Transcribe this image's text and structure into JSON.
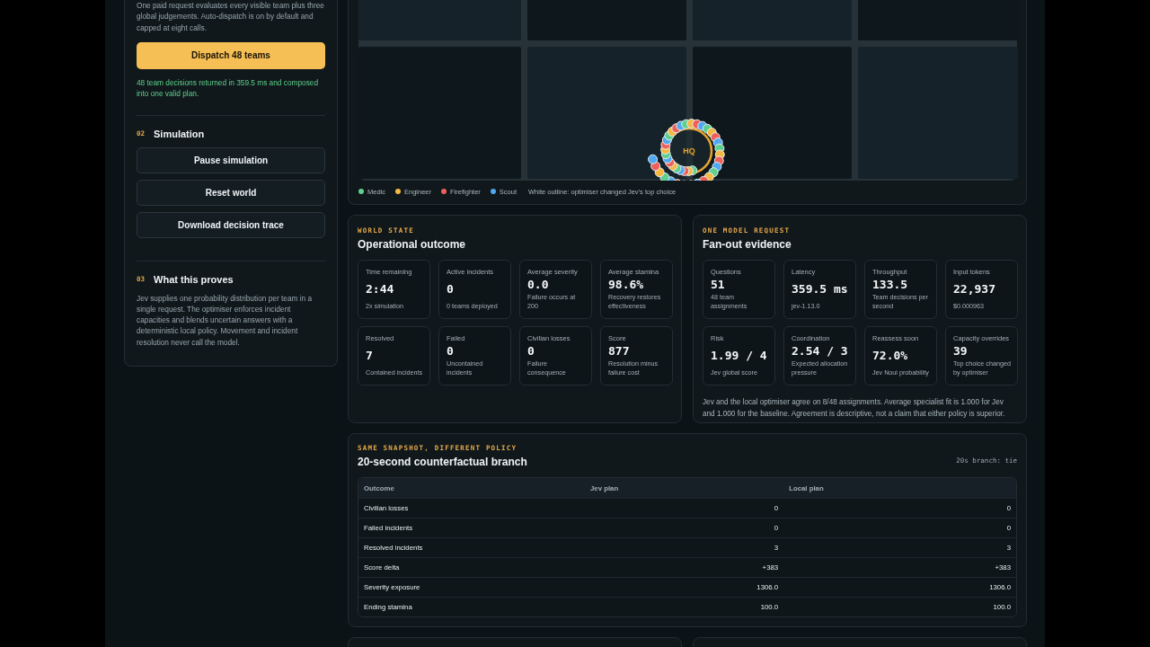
{
  "dispatch": {
    "description": "One paid request evaluates every visible team plus three global judgements. Auto-dispatch is on by default and capped at eight calls.",
    "button": "Dispatch 48 teams",
    "status": "48 team decisions returned in 359.5 ms and composed into one valid plan."
  },
  "simulation": {
    "number": "02",
    "title": "Simulation",
    "buttons": [
      "Pause simulation",
      "Reset world",
      "Download decision trace"
    ]
  },
  "proof": {
    "number": "03",
    "title": "What this proves",
    "text": "Jev supplies one probability distribution per team in a single request. The optimiser enforces incident capacities and blends uncertain answers with a deterministic local policy. Movement and incident resolution never call the model."
  },
  "map": {
    "hq_label": "HQ",
    "legend": [
      {
        "label": "Medic",
        "color": "#5fcf8f"
      },
      {
        "label": "Engineer",
        "color": "#f5b942"
      },
      {
        "label": "Firefighter",
        "color": "#f0605a"
      },
      {
        "label": "Scout",
        "color": "#4fa8f0"
      }
    ],
    "legend_note": "White outline: optimiser changed Jev’s top choice"
  },
  "world_state": {
    "eyebrow": "WORLD STATE",
    "title": "Operational outcome",
    "tiles": [
      {
        "label": "Time remaining",
        "value": "2:44",
        "note": "2x simulation"
      },
      {
        "label": "Active incidents",
        "value": "0",
        "note": "0 teams deployed"
      },
      {
        "label": "Average severity",
        "value": "0.0",
        "note": "Failure occurs at 200"
      },
      {
        "label": "Average stamina",
        "value": "98.6%",
        "note": "Recovery restores effectiveness"
      },
      {
        "label": "Resolved",
        "value": "7",
        "note": "Contained incidents"
      },
      {
        "label": "Failed",
        "value": "0",
        "note": "Uncontained incidents"
      },
      {
        "label": "Civilian losses",
        "value": "0",
        "note": "Failure consequence"
      },
      {
        "label": "Score",
        "value": "877",
        "note": "Resolution minus failure cost"
      }
    ]
  },
  "model_request": {
    "eyebrow": "ONE MODEL REQUEST",
    "title": "Fan-out evidence",
    "tiles": [
      {
        "label": "Questions",
        "value": "51",
        "note": "48 team assignments"
      },
      {
        "label": "Latency",
        "value": "359.5 ms",
        "note": "jev-1.13.0"
      },
      {
        "label": "Throughput",
        "value": "133.5",
        "note": "Team decisions per second"
      },
      {
        "label": "Input tokens",
        "value": "22,937",
        "note": "$0.000963"
      },
      {
        "label": "Risk",
        "value": "1.99 / 4",
        "note": "Jev global score"
      },
      {
        "label": "Coordination",
        "value": "2.54 / 3",
        "note": "Expected allocation pressure"
      },
      {
        "label": "Reassess soon",
        "value": "72.0%",
        "note": "Jev Noui probability"
      },
      {
        "label": "Capacity overrides",
        "value": "39",
        "note": "Top choice changed by optimiser"
      }
    ],
    "summary": "Jev and the local optimiser agree on 8/48 assignments. Average specialist fit is 1.000 for Jev and 1.000 for the baseline. Agreement is descriptive, not a claim that either policy is superior."
  },
  "counterfactual": {
    "eyebrow": "SAME SNAPSHOT, DIFFERENT POLICY",
    "title": "20-second counterfactual branch",
    "badge": "20s branch: tie",
    "table": {
      "columns": [
        "Outcome",
        "Jev plan",
        "Local plan"
      ],
      "rows": [
        [
          "Civilian losses",
          "0",
          "0"
        ],
        [
          "Failed incidents",
          "0",
          "0"
        ],
        [
          "Resolved incidents",
          "3",
          "3"
        ],
        [
          "Score delta",
          "+383",
          "+383"
        ],
        [
          "Severity exposure",
          "1306.0",
          "1306.0"
        ],
        [
          "Ending stamina",
          "100.0",
          "100.0"
        ]
      ]
    }
  }
}
